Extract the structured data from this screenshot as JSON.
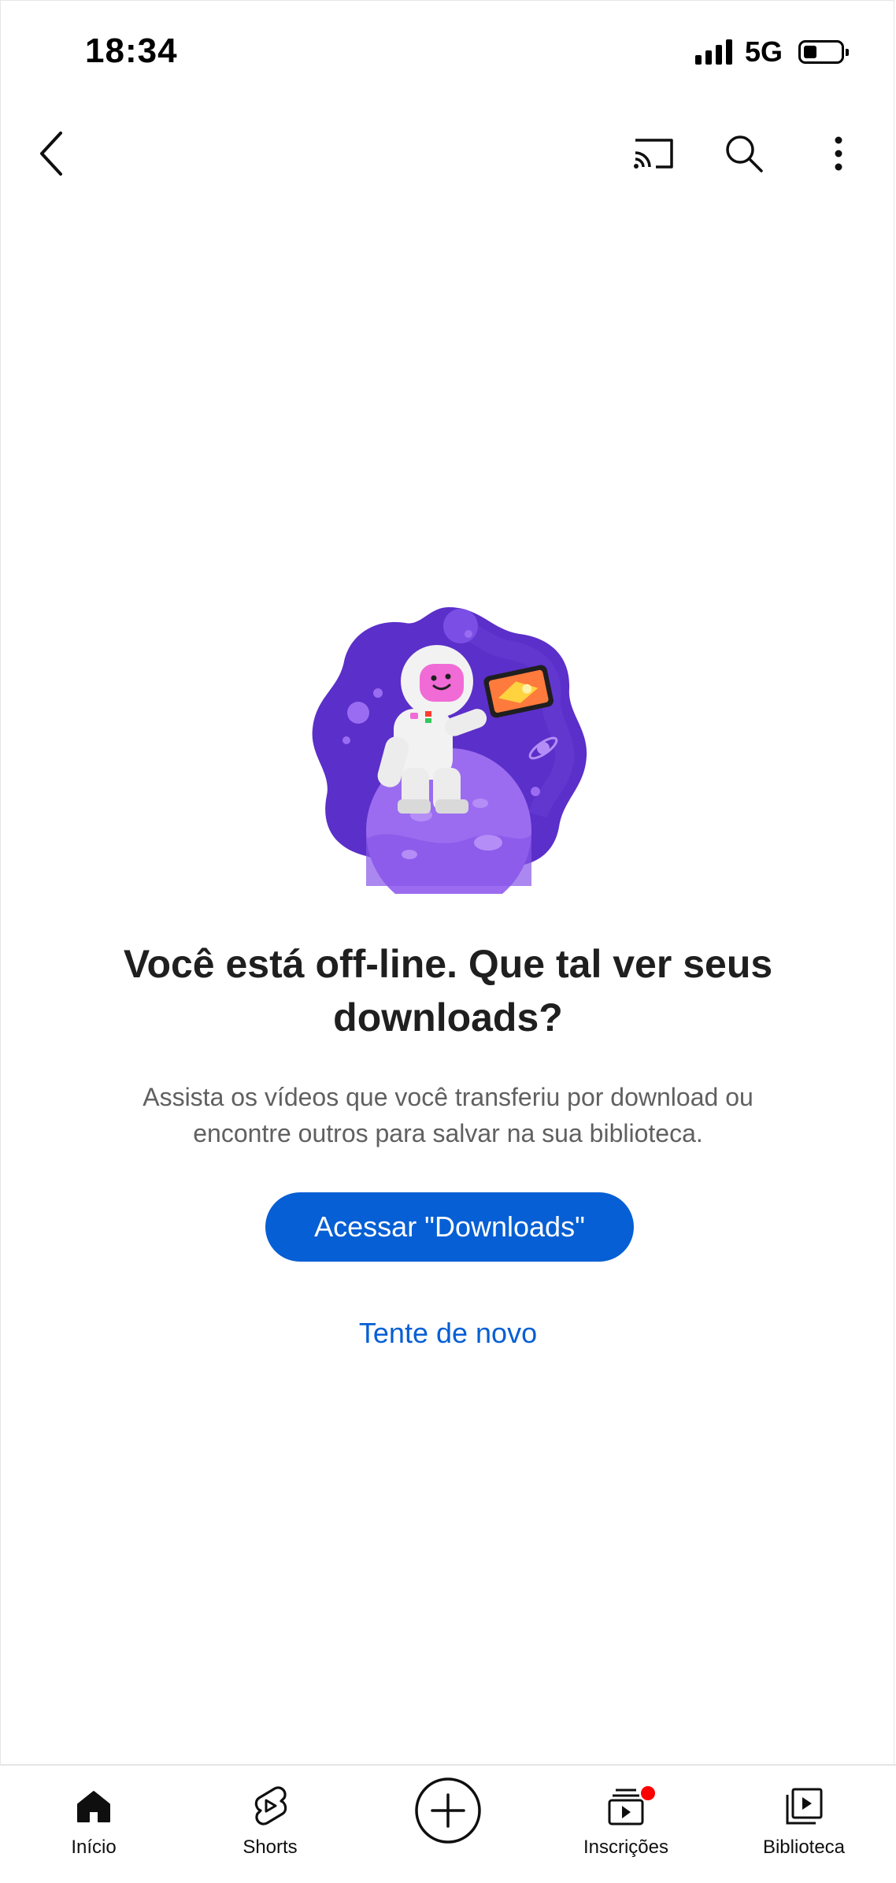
{
  "status_bar": {
    "time": "18:34",
    "network": "5G",
    "signal_bars": 4,
    "battery_level": 0.25
  },
  "toolbar": {
    "back_icon": "chevron-left-icon",
    "cast_icon": "cast-icon",
    "search_icon": "search-icon",
    "more_icon": "more-vert-icon"
  },
  "main": {
    "illustration": "astronaut-on-planet-illustration",
    "headline_line1": "Você está off-line. Que tal ver seus",
    "headline_line2": "downloads?",
    "subtext_line1": "Assista os vídeos que você transferiu por download ou",
    "subtext_line2": "encontre outros para salvar na sua biblioteca.",
    "primary_button": "Acessar \"Downloads\"",
    "retry_link": "Tente de novo"
  },
  "bottom_nav": {
    "items": [
      {
        "label": "Início",
        "icon": "home-icon"
      },
      {
        "label": "Shorts",
        "icon": "shorts-icon"
      },
      {
        "label": "",
        "icon": "create-plus-icon"
      },
      {
        "label": "Inscrições",
        "icon": "subscriptions-icon"
      },
      {
        "label": "Biblioteca",
        "icon": "library-icon"
      }
    ]
  },
  "colors": {
    "accent": "#065fd4",
    "notification_dot": "#ff0000",
    "illustration_purple": "#5b2fc9"
  }
}
